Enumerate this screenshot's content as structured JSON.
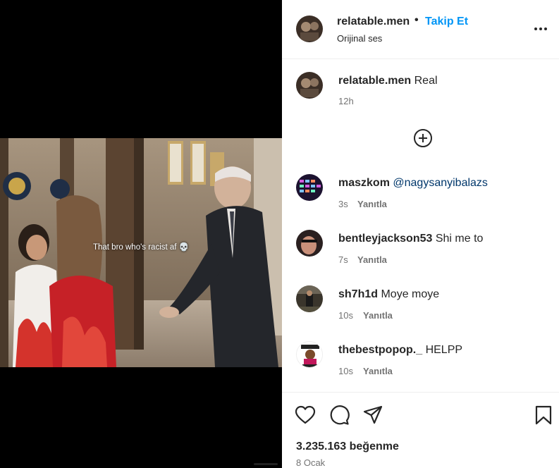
{
  "video": {
    "caption": "That bro who's racist af 💀"
  },
  "post": {
    "username": "relatable.men",
    "separator": "•",
    "follow_label": "Takip Et",
    "audio": "Orijinal ses",
    "caption_user": "relatable.men",
    "caption_text": "Real",
    "caption_time": "12h"
  },
  "comments": [
    {
      "user": "maszkom",
      "mention": "@nagysanyibalazs",
      "text": "",
      "time": "3s",
      "reply_label": "Yanıtla"
    },
    {
      "user": "bentleyjackson53",
      "mention": "",
      "text": "Shi me to",
      "time": "7s",
      "reply_label": "Yanıtla"
    },
    {
      "user": "sh7h1d",
      "mention": "",
      "text": "Moye moye",
      "time": "10s",
      "reply_label": "Yanıtla"
    },
    {
      "user": "thebestpopop._",
      "mention": "",
      "text": "HELPP",
      "time": "10s",
      "reply_label": "Yanıtla"
    }
  ],
  "stats": {
    "likes": "3.235.163 beğenme",
    "date": "8 Ocak"
  },
  "icons": {
    "more": "more-options-icon",
    "load_more": "load-more-comments-icon",
    "like": "heart-icon",
    "comment": "comment-icon",
    "share": "share-icon",
    "save": "bookmark-icon"
  },
  "colors": {
    "accent": "#0095f6",
    "muted": "#737373",
    "text": "#262626",
    "mention": "#00376b"
  }
}
